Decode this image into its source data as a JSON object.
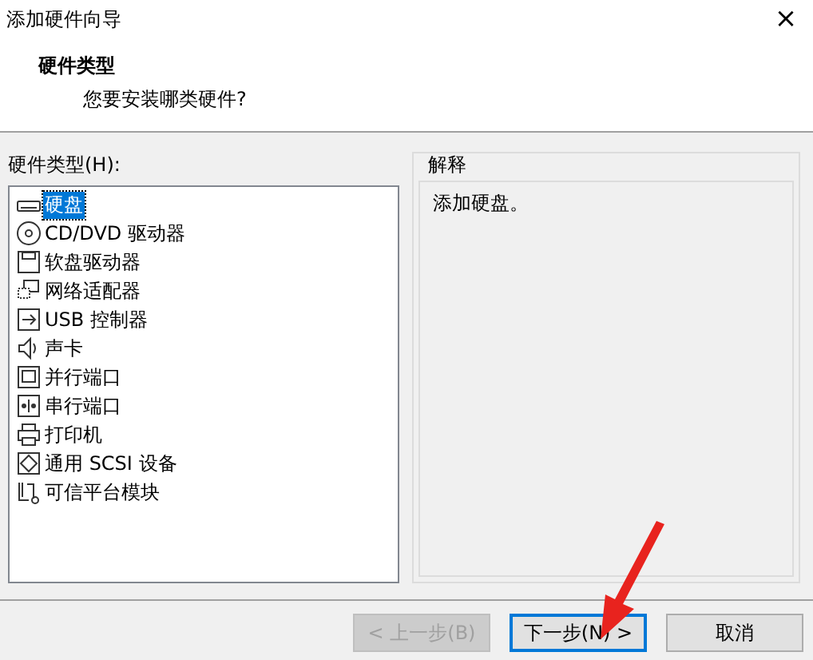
{
  "window": {
    "title": "添加硬件向导",
    "close": "×"
  },
  "header": {
    "title": "硬件类型",
    "subtitle": "您要安装哪类硬件?"
  },
  "hardware_list": {
    "label": "硬件类型(H):",
    "items": [
      {
        "label": "硬盘",
        "selected": true
      },
      {
        "label": "CD/DVD 驱动器",
        "selected": false
      },
      {
        "label": "软盘驱动器",
        "selected": false
      },
      {
        "label": "网络适配器",
        "selected": false
      },
      {
        "label": "USB 控制器",
        "selected": false
      },
      {
        "label": "声卡",
        "selected": false
      },
      {
        "label": "并行端口",
        "selected": false
      },
      {
        "label": "串行端口",
        "selected": false
      },
      {
        "label": "打印机",
        "selected": false
      },
      {
        "label": "通用 SCSI 设备",
        "selected": false
      },
      {
        "label": "可信平台模块",
        "selected": false
      }
    ]
  },
  "explanation": {
    "title": "解释",
    "text": "添加硬盘。"
  },
  "buttons": [
    {
      "label": "< 上一步(B)",
      "disabled": true,
      "default": false
    },
    {
      "label": "下一步(N) >",
      "disabled": false,
      "default": true
    },
    {
      "label": "取消",
      "disabled": false,
      "default": false
    }
  ]
}
